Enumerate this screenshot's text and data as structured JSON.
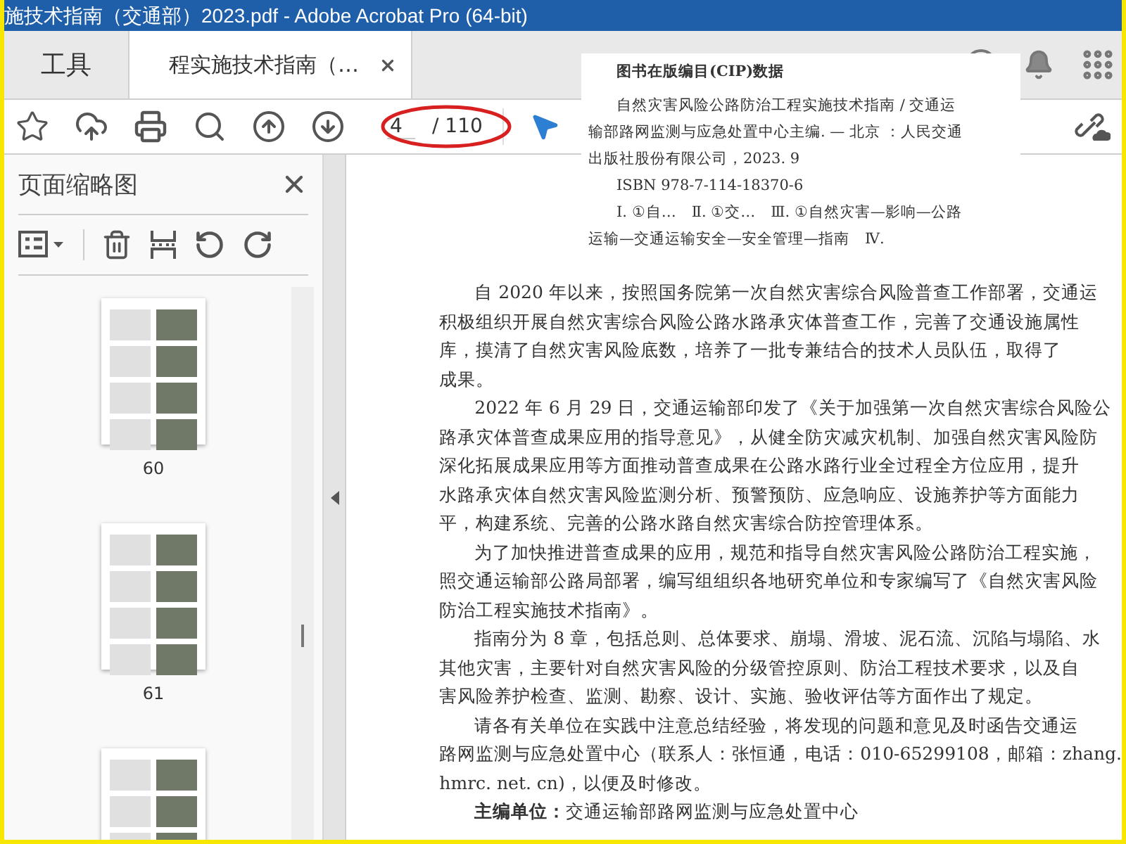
{
  "window": {
    "title": "施技术指南（交通部）2023.pdf - Adobe Acrobat Pro (64-bit)"
  },
  "tabs": [
    {
      "label": "工具",
      "selected": false,
      "closable": false
    },
    {
      "label": "程实施技术指南（…",
      "selected": true,
      "closable": true
    }
  ],
  "page_nav": {
    "current": "4",
    "total": "/ 110"
  },
  "cip_overlay": {
    "lines": [
      {
        "text": "图书在版编目(CIP)数据",
        "kind": "heading"
      },
      {
        "text": "自然灾害风险公路防治工程实施技术指南 / 交通运",
        "kind": "indent"
      },
      {
        "text": "输部路网监测与应急处置中心主编. — 北京 ：人民交通",
        "kind": "plain"
      },
      {
        "text": "出版社股份有限公司，2023. 9",
        "kind": "plain"
      },
      {
        "text": "ISBN 978-7-114-18370-6",
        "kind": "indent"
      },
      {
        "text": "Ⅰ. ①自…　Ⅱ. ①交…　Ⅲ. ①自然灾害—影响—公路",
        "kind": "indent"
      },
      {
        "text": "运输—交通运输安全—安全管理—指南　Ⅳ.",
        "kind": "plain"
      }
    ]
  },
  "thumbnails_panel": {
    "title": "页面缩略图",
    "pages": [
      {
        "kind": "labeled",
        "label": "60"
      },
      {
        "kind": "labeled",
        "label": "61"
      },
      {
        "kind": "cut_off"
      }
    ]
  },
  "document": {
    "paragraphs": [
      {
        "lines": [
          "自 2020 年以来，按照国务院第一次自然灾害综合风险普查工作部署，交通运",
          "积极组织开展自然灾害综合风险公路水路承灾体普查工作，完善了交通设施属性",
          "库，摸清了自然灾害风险底数，培养了一批专兼结合的技术人员队伍，取得了",
          "成果。"
        ]
      },
      {
        "lines": [
          "2022 年 6 月 29 日，交通运输部印发了《关于加强第一次自然灾害综合风险公",
          "路承灾体普查成果应用的指导意见》，从健全防灾减灾机制、加强自然灾害风险防",
          "深化拓展成果应用等方面推动普查成果在公路水路行业全过程全方位应用，提升",
          "水路承灾体自然灾害风险监测分析、预警预防、应急响应、设施养护等方面能力",
          "平，构建系统、完善的公路水路自然灾害综合防控管理体系。"
        ]
      },
      {
        "lines": [
          "为了加快推进普查成果的应用，规范和指导自然灾害风险公路防治工程实施，",
          "照交通运输部公路局部署，编写组组织各地研究单位和专家编写了《自然灾害风险",
          "防治工程实施技术指南》。"
        ]
      },
      {
        "lines": [
          "指南分为 8 章，包括总则、总体要求、崩塌、滑坡、泥石流、沉陷与塌陷、水",
          "其他灾害，主要针对自然灾害风险的分级管控原则、防治工程技术要求，以及自",
          "害风险养护检查、监测、勘察、设计、实施、验收评估等方面作出了规定。"
        ]
      },
      {
        "lines": [
          "请各有关单位在实践中注意总结经验，将发现的问题和意见及时函告交通运",
          "路网监测与应急处置中心（联系人：张恒通，电话：010-65299108，邮箱：zhang.",
          "hmrc. net. cn)，以便及时修改。"
        ]
      },
      {
        "lines": [
          "**主编单位：**交通运输部路网监测与应急处置中心"
        ]
      }
    ]
  }
}
